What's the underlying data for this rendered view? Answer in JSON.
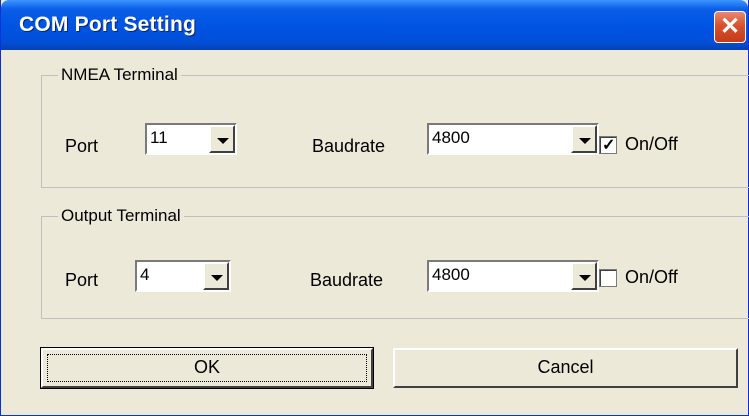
{
  "window": {
    "title": "COM Port Setting"
  },
  "nmea": {
    "legend": "NMEA Terminal",
    "port_label": "Port",
    "port_value": "11",
    "baud_label": "Baudrate",
    "baud_value": "4800",
    "onoff_label": "On/Off",
    "onoff_checked": true,
    "check_glyph": "✓"
  },
  "output": {
    "legend": "Output Terminal",
    "port_label": "Port",
    "port_value": "4",
    "baud_label": "Baudrate",
    "baud_value": "4800",
    "onoff_label": "On/Off",
    "onoff_checked": false
  },
  "buttons": {
    "ok": "OK",
    "cancel": "Cancel"
  },
  "icons": {
    "close": "close-icon",
    "dropdown": "chevron-down-icon"
  },
  "colors": {
    "titlebar": "#0054e3",
    "close": "#d9512f",
    "face": "#ece9d8"
  }
}
